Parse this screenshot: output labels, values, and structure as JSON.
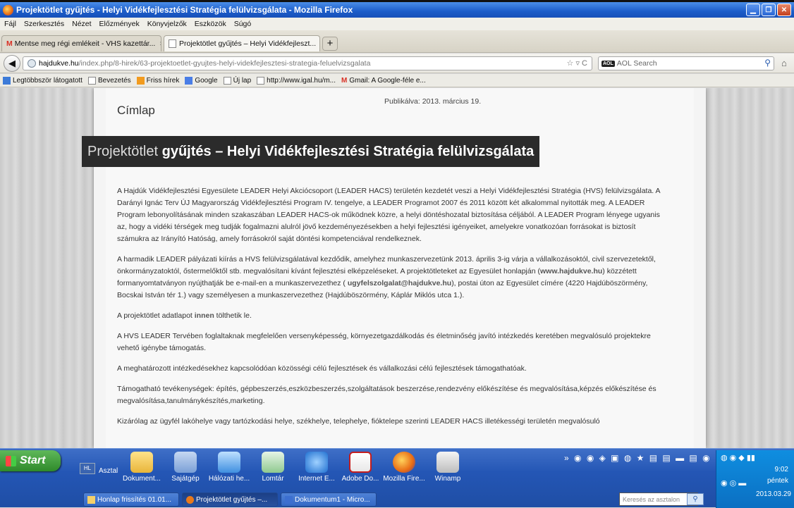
{
  "window": {
    "title": "Projektötlet gyűjtés - Helyi Vidékfejlesztési Stratégia felülvizsgálata - Mozilla Firefox"
  },
  "menu": [
    "Fájl",
    "Szerkesztés",
    "Nézet",
    "Előzmények",
    "Könyvjelzők",
    "Eszközök",
    "Súgó"
  ],
  "tabs": [
    {
      "label": "Mentse meg régi emlékeit - VHS kazettár...",
      "close": "×"
    },
    {
      "label": "Projektötlet gyűjtés – Helyi Vidékfejleszt...",
      "close": "×"
    }
  ],
  "new_tab": "+",
  "nav": {
    "url_domain": "hajdukve.hu",
    "url_path": "/index.php/8-hirek/63-projektoetlet-gyujtes-helyi-videkfejlesztesi-strategia-feluelvizsgalata",
    "url_icons": "☆ ▿ C",
    "search_engine": "AOL",
    "search_placeholder": "AOL Search"
  },
  "bookmarks": [
    "Legtöbbször látogatott",
    "Bevezetés",
    "Friss hírek",
    "Google",
    "Új lap",
    "http://www.igal.hu/m...",
    "Gmail: A Google-féle e..."
  ],
  "page": {
    "published": "Publikálva: 2013. március 19.",
    "section": "Címlap",
    "title_part1": "Projektötlet",
    "title_part2": "gyűjtés – Helyi Vidékfejlesztési Stratégia felülvizsgálata",
    "p1": "A Hajdúk Vidékfejlesztési Egyesülete LEADER Helyi Akciócsoport (LEADER HACS) területén kezdetét veszi a Helyi Vidékfejlesztési Stratégia (HVS) felülvizsgálata. A Darányi Ignác Terv ÚJ Magyarország Vidékfejlesztési Program IV. tengelye, a LEADER Programot 2007 és 2011 között két alkalommal nyitották meg. A LEADER Program lebonyolításának minden szakaszában LEADER HACS-ok működnek közre, a helyi döntéshozatal biztosítása céljából. A LEADER Program lényege ugyanis az, hogy a vidéki térségek meg tudják fogalmazni alulról jövő kezdeményezésekben a helyi fejlesztési igényeiket, amelyekre vonatkozóan forrásokat is biztosít számukra az Irányító Hatóság, amely forrásokról saját döntési kompetenciával rendelkeznek.",
    "p2a": "A harmadik LEADER pályázati kiírás a HVS felülvizsgálatával kezdődik, amelyhez munkaszervezetünk 2013. április 3-ig várja a vállalkozásoktól, civil szervezetektől, önkormányzatoktól, őstermelőktől stb. megvalósítani kívánt fejlesztési elképzeléseket. A projektötleteket az Egyesület honlapján (",
    "p2_link1": "www.hajdukve.hu",
    "p2b": ") közzétett formanyomtatványon nyújthatják be e-mail-en a munkaszervezethez ( ",
    "p2_link2": "ugyfelszolgalat@hajdukve.hu",
    "p2c": "), postai úton az Egyesület címére (4220 Hajdúböszörmény, Bocskai István tér 1.) vagy személyesen a munkaszervezethez (Hajdúböszörmény, Káplár Miklós utca 1.).",
    "p3a": " A projektötlet adatlapot ",
    "p3_link": "innen",
    "p3b": " tölthetik le.",
    "p4": "A HVS LEADER Tervében foglaltaknak megfelelően versenyképesség, környezetgazdálkodás és életminőség javító intézkedés keretében megvalósuló projektekre vehető igénybe támogatás.",
    "p5": "A meghatározott intézkedésekhez kapcsolódóan közösségi célú fejlesztések és vállalkozási célú fejlesztések támogathatóak.",
    "p6": "Támogatható tevékenységek: építés, gépbeszerzés,eszközbeszerzés,szolgáltatások beszerzése,rendezvény előkészítése és megvalósítása,képzés előkészítése és megvalósítása,tanulmánykészítés,marketing.",
    "p7": "Kizárólag az ügyfél lakóhelye vagy tartózkodási helye, székhelye, telephelye, fióktelepe szerinti LEADER HACS illetékességi területén megvalósuló"
  },
  "taskbar": {
    "start": "Start",
    "hl": "HL",
    "desktop": "Asztal",
    "quick_launch": [
      "Dokument...",
      "Sajátgép",
      "Hálózati he...",
      "Lomtár",
      "Internet E...",
      "Adobe Do...",
      "Mozilla Fire...",
      "Winamp"
    ],
    "tasks": [
      "Honlap frissítés 01.01...",
      "Projektötlet gyűjtés –...",
      "Dokumentum1 - Micro..."
    ],
    "search_placeholder": "Keresés az asztalon",
    "clock": "9:02",
    "day": "péntek",
    "date": "2013.03.29"
  }
}
